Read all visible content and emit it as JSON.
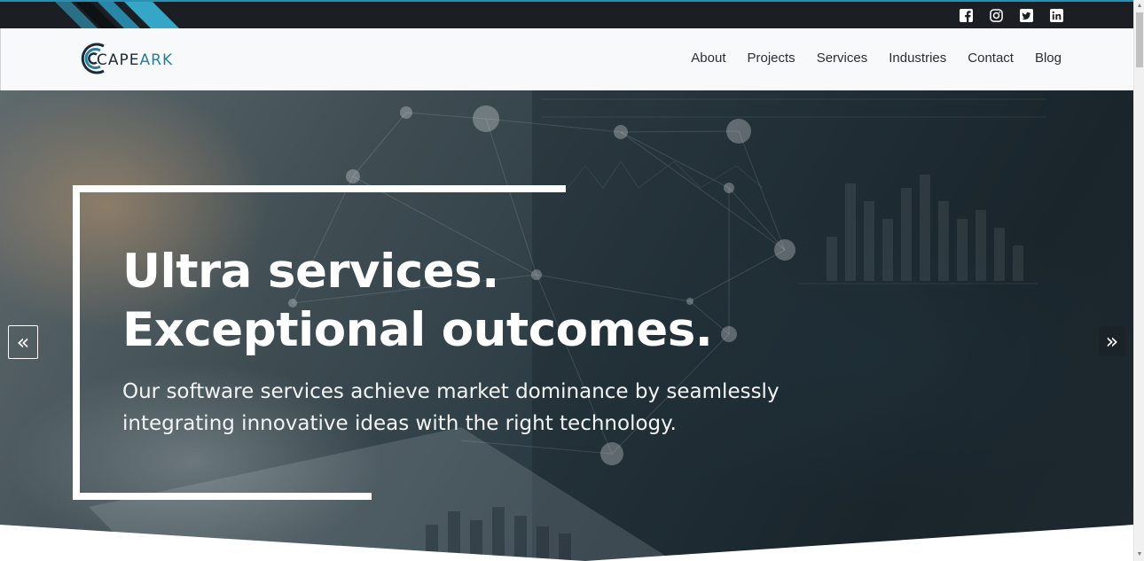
{
  "brand": {
    "logo_part1": "CAPE",
    "logo_part2": "ARK",
    "colors": {
      "dark": "#1e2b36",
      "accent": "#2b7f9c"
    }
  },
  "topbar": {
    "socials": [
      {
        "name": "facebook",
        "icon": "facebook-square-icon"
      },
      {
        "name": "instagram",
        "icon": "instagram-icon"
      },
      {
        "name": "twitter",
        "icon": "twitter-square-icon"
      },
      {
        "name": "linkedin",
        "icon": "linkedin-icon"
      }
    ]
  },
  "nav": {
    "items": [
      "About",
      "Projects",
      "Services",
      "Industries",
      "Contact",
      "Blog"
    ]
  },
  "hero": {
    "headline_line1": "Ultra services.",
    "headline_line2": "Exceptional outcomes.",
    "subtext": "Our software services achieve market dominance by seamlessly integrating innovative ideas with the right technology.",
    "prev_icon": "double-chevron-left-icon",
    "next_icon": "double-chevron-right-icon",
    "prev_glyph": "«",
    "next_glyph": "»"
  }
}
